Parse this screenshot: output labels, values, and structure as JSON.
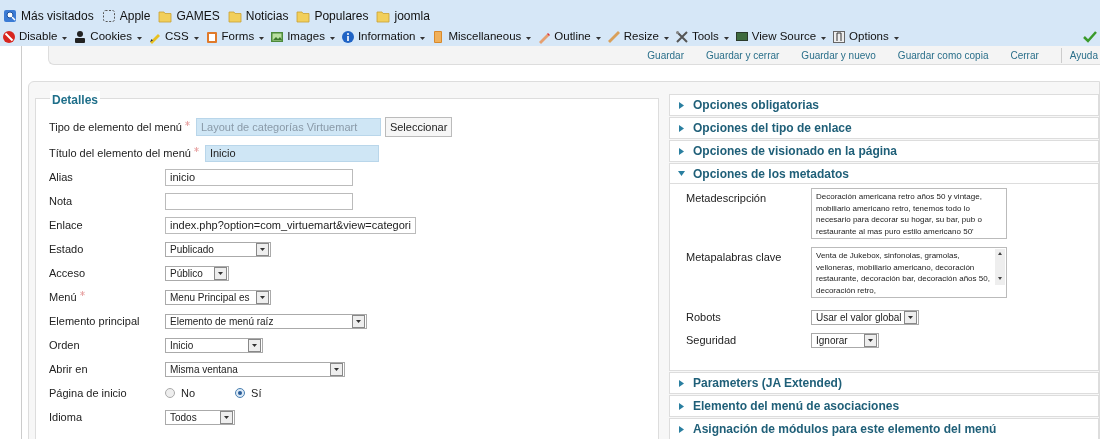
{
  "bookmarks": [
    {
      "label": "Más visitados",
      "kind": "history"
    },
    {
      "label": "Apple",
      "kind": "page"
    },
    {
      "label": "GAMES",
      "kind": "folder"
    },
    {
      "label": "Noticias",
      "kind": "folder"
    },
    {
      "label": "Populares",
      "kind": "folder"
    },
    {
      "label": "joomla",
      "kind": "folder"
    }
  ],
  "devtools": [
    {
      "label": "Disable",
      "kind": "disable"
    },
    {
      "label": "Cookies",
      "kind": "cookies"
    },
    {
      "label": "CSS",
      "kind": "css"
    },
    {
      "label": "Forms",
      "kind": "forms"
    },
    {
      "label": "Images",
      "kind": "images"
    },
    {
      "label": "Information",
      "kind": "information"
    },
    {
      "label": "Miscellaneous",
      "kind": "misc"
    },
    {
      "label": "Outline",
      "kind": "outline"
    },
    {
      "label": "Resize",
      "kind": "resize"
    },
    {
      "label": "Tools",
      "kind": "tools"
    },
    {
      "label": "View Source",
      "kind": "source"
    },
    {
      "label": "Options",
      "kind": "options"
    }
  ],
  "actions": [
    "Guardar",
    "Guardar y cerrar",
    "Guardar y nuevo",
    "Guardar como copia",
    "Cerrar",
    "Ayuda"
  ],
  "details": {
    "legend": "Detalles",
    "fields": [
      {
        "label": "Tipo de elemento del menú",
        "required": true,
        "kind": "chooser",
        "value": "Layout de categorías Virtuemart",
        "button": "Seleccionar"
      },
      {
        "label": "Título del elemento del menú",
        "required": true,
        "kind": "text",
        "value": "Inicio",
        "highlighted": true
      },
      {
        "label": "Alias",
        "required": false,
        "kind": "text",
        "value": "inicio",
        "highlighted": false
      },
      {
        "label": "Nota",
        "required": false,
        "kind": "text",
        "highlighted": false
      },
      {
        "label": "Enlace",
        "required": false,
        "kind": "text",
        "value": "index.php?option=com_virtuemart&view=categori",
        "highlighted": false
      },
      {
        "label": "Estado",
        "required": false,
        "kind": "select",
        "value": "Publicado"
      },
      {
        "label": "Acceso",
        "required": false,
        "kind": "select",
        "value": "Público"
      },
      {
        "label": "Menú",
        "required": true,
        "kind": "select",
        "value": "Menu Principal es"
      },
      {
        "label": "Elemento principal",
        "required": false,
        "kind": "select",
        "value": "Elemento de menú raíz"
      },
      {
        "label": "Orden",
        "required": false,
        "kind": "select",
        "value": "Inicio"
      },
      {
        "label": "Abrir en",
        "required": false,
        "kind": "select",
        "value": "Misma ventana"
      },
      {
        "label": "Página de inicio",
        "required": false,
        "kind": "radio",
        "options": [
          {
            "label": "No",
            "selected": false
          },
          {
            "label": "Sí",
            "selected": true
          }
        ]
      },
      {
        "label": "Idioma",
        "required": false,
        "kind": "select",
        "value": "Todos"
      }
    ]
  },
  "panels": [
    {
      "title": "Opciones obligatorias",
      "expanded": false
    },
    {
      "title": "Opciones del tipo de enlace",
      "expanded": false
    },
    {
      "title": "Opciones de visionado en la página",
      "expanded": false
    },
    {
      "title": "Opciones de los metadatos",
      "expanded": true,
      "fields": [
        {
          "label": "Metadescripción",
          "kind": "textarea",
          "value": "Decoración americana retro años 50 y vintage, mobiliario americano retro, tenemos todo lo necesario para decorar su hogar, su bar, pub o restaurante al mas puro estilo americano 50'",
          "scroll": false
        },
        {
          "label": "Metapalabras clave",
          "kind": "textarea",
          "value": "Venta de Jukebox, sinfonolas, gramolas, velloneras, mobiliario americano, decoración restaurante, decoración bar, decoración años 50, decoración retro,",
          "scroll": true
        },
        {
          "label": "Robots",
          "kind": "select",
          "value": "Usar el valor global"
        },
        {
          "label": "Seguridad",
          "kind": "select",
          "value": "Ignorar"
        }
      ]
    },
    {
      "title": "Parameters (JA Extended)",
      "expanded": false
    },
    {
      "title": "Elemento del menú de asociaciones",
      "expanded": false
    },
    {
      "title": "Asignación de módulos para este elemento del menú",
      "expanded": false
    }
  ]
}
